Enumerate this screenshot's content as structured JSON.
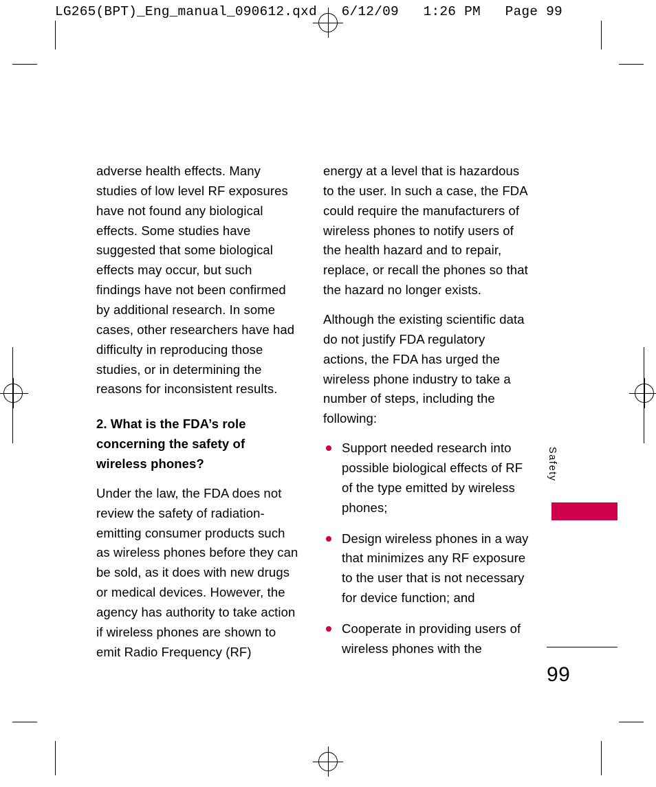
{
  "print_header": "LG265(BPT)_Eng_manual_090612.qxd   6/12/09   1:26 PM   Page 99",
  "left_column": {
    "paragraph_1": "adverse health effects. Many studies of low level RF exposures have not found any biological effects. Some studies have suggested that some biological effects may occur, but such findings have not been confirmed by additional research. In some cases, other researchers have had difficulty in reproducing those studies, or in determining the reasons for inconsistent results.",
    "heading": "2. What is the FDA’s role concerning the safety of wireless phones?",
    "paragraph_2": "Under the law, the FDA does not review the safety of radiation-emitting consumer products such as wireless phones before they can be sold, as it does with new drugs or medical devices. However, the agency has authority to take action if wireless phones are shown to emit Radio Frequency (RF)"
  },
  "right_column": {
    "paragraph_1": "energy at a level that is hazardous to the user. In such a case, the FDA could require the manufacturers of wireless phones to notify users of the health hazard and to repair, replace, or recall the phones so that the hazard no longer exists.",
    "paragraph_2": "Although the existing scientific data do not justify FDA regulatory actions, the FDA has urged the wireless phone industry to take a number of steps, including the following:",
    "bullets": [
      "Support needed research into possible biological effects of RF of the type emitted by wireless phones;",
      "Design wireless phones in a way that minimizes any RF exposure to the user that is not necessary for device function; and",
      "Cooperate in providing users of wireless phones with the"
    ]
  },
  "side_tab": {
    "label": "Safety",
    "color": "#d1004b"
  },
  "page_number": "99"
}
